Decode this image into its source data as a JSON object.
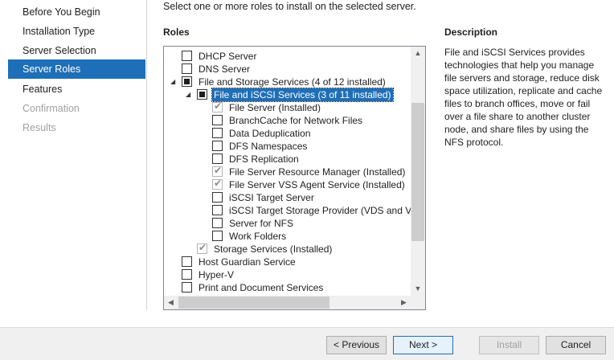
{
  "nav": {
    "items": [
      {
        "label": "Before You Begin",
        "state": "normal"
      },
      {
        "label": "Installation Type",
        "state": "normal"
      },
      {
        "label": "Server Selection",
        "state": "normal"
      },
      {
        "label": "Server Roles",
        "state": "active"
      },
      {
        "label": "Features",
        "state": "normal"
      },
      {
        "label": "Confirmation",
        "state": "disabled"
      },
      {
        "label": "Results",
        "state": "disabled"
      }
    ]
  },
  "main": {
    "instructions": "Select one or more roles to install on the selected server.",
    "roles_label": "Roles",
    "description_title": "Description",
    "description_text": "File and iSCSI Services provides technologies that help you manage file servers and storage, reduce disk space utilization, replicate and cache files to branch offices, move or fail over a file share to another cluster node, and share files by using the NFS protocol."
  },
  "roles_tree": [
    {
      "label": "DHCP Server",
      "level": 0,
      "state": "unchecked"
    },
    {
      "label": "DNS Server",
      "level": 0,
      "state": "unchecked"
    },
    {
      "label": "File and Storage Services (4 of 12 installed)",
      "level": 0,
      "state": "partial",
      "expanded": true
    },
    {
      "label": "File and iSCSI Services (3 of 11 installed)",
      "level": 1,
      "state": "partial",
      "expanded": true,
      "selected": true
    },
    {
      "label": "File Server (Installed)",
      "level": 2,
      "state": "checked-disabled"
    },
    {
      "label": "BranchCache for Network Files",
      "level": 2,
      "state": "unchecked"
    },
    {
      "label": "Data Deduplication",
      "level": 2,
      "state": "unchecked"
    },
    {
      "label": "DFS Namespaces",
      "level": 2,
      "state": "unchecked"
    },
    {
      "label": "DFS Replication",
      "level": 2,
      "state": "unchecked"
    },
    {
      "label": "File Server Resource Manager (Installed)",
      "level": 2,
      "state": "checked-disabled"
    },
    {
      "label": "File Server VSS Agent Service (Installed)",
      "level": 2,
      "state": "checked-disabled"
    },
    {
      "label": "iSCSI Target Server",
      "level": 2,
      "state": "unchecked"
    },
    {
      "label": "iSCSI Target Storage Provider (VDS and VSS",
      "level": 2,
      "state": "unchecked"
    },
    {
      "label": "Server for NFS",
      "level": 2,
      "state": "unchecked"
    },
    {
      "label": "Work Folders",
      "level": 2,
      "state": "unchecked"
    },
    {
      "label": "Storage Services (Installed)",
      "level": 1,
      "state": "checked-disabled"
    },
    {
      "label": "Host Guardian Service",
      "level": 0,
      "state": "unchecked"
    },
    {
      "label": "Hyper-V",
      "level": 0,
      "state": "unchecked"
    },
    {
      "label": "Print and Document Services",
      "level": 0,
      "state": "unchecked"
    }
  ],
  "buttons": {
    "previous": "< Previous",
    "next": "Next >",
    "install": "Install",
    "cancel": "Cancel"
  },
  "icons": {
    "expanded": "expanded-triangle-icon",
    "scroll_up": "chevron-up-icon",
    "scroll_down": "chevron-down-icon",
    "scroll_left": "chevron-left-icon",
    "scroll_right": "chevron-right-icon"
  },
  "colors": {
    "accent": "#1e6fb8"
  }
}
